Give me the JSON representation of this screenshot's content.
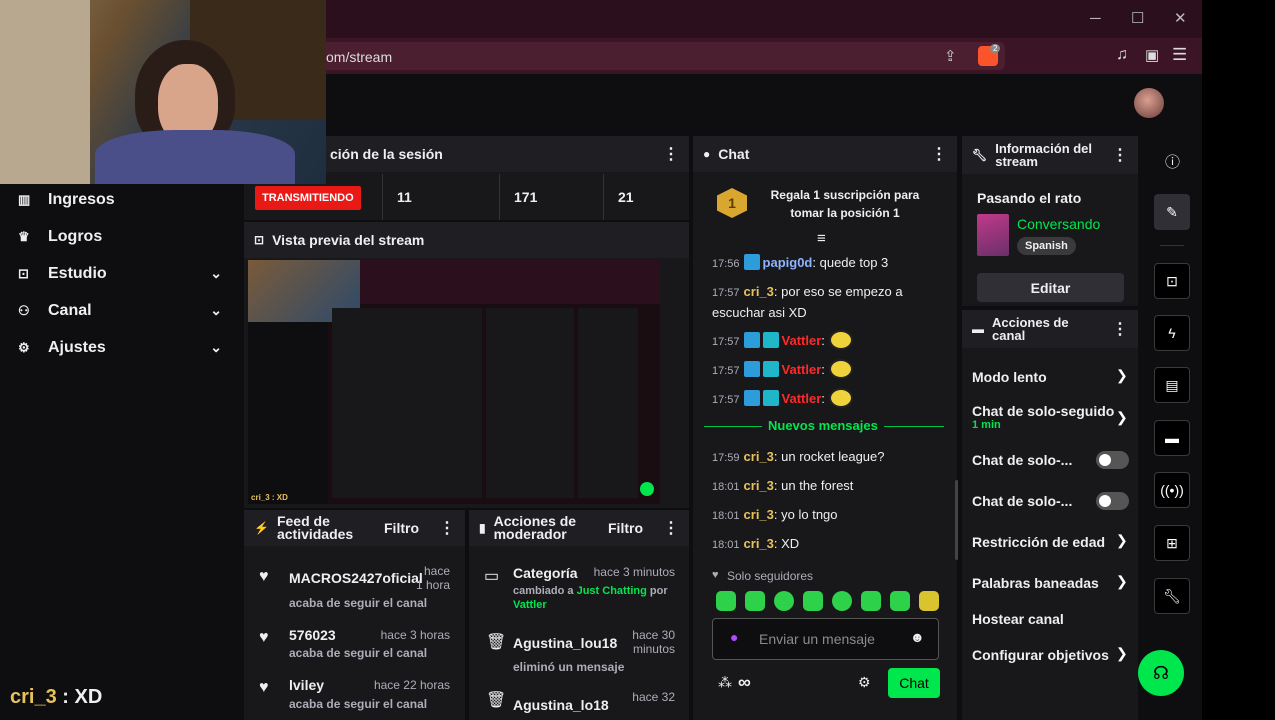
{
  "browser": {
    "url": "om/stream",
    "shield_count": "2",
    "window_controls": [
      "minimize-icon",
      "maximize-icon",
      "close-icon"
    ]
  },
  "sidebar": {
    "items": [
      {
        "label": "Ingresos",
        "icon": "chart-icon"
      },
      {
        "label": "Logros",
        "icon": "trophy-icon"
      },
      {
        "label": "Estudio",
        "icon": "camera-icon"
      },
      {
        "label": "Canal",
        "icon": "users-icon"
      },
      {
        "label": "Ajustes",
        "icon": "gear-icon"
      }
    ]
  },
  "session": {
    "title": "ción de la sesión",
    "status": "TRANSMITIENDO",
    "stats": [
      "11",
      "171",
      "21"
    ]
  },
  "preview": {
    "title": "Vista previa del stream",
    "caption": "cri_3 : XD"
  },
  "overlay_caption": {
    "user": "cri_3",
    "text": ": XD"
  },
  "chat": {
    "title": "Chat",
    "banner": "Regala 1 suscripción para tomar la posición 1",
    "banner_rank": "1",
    "messages_before": [
      {
        "time": "17:56",
        "user": "papig0d",
        "text": "quede top 3"
      },
      {
        "time": "17:57",
        "user": "cri_3",
        "text": "por eso se empezo a escuchar asi XD"
      },
      {
        "time": "17:57",
        "user": "Vattler",
        "text": ""
      },
      {
        "time": "17:57",
        "user": "Vattler",
        "text": ""
      },
      {
        "time": "17:57",
        "user": "Vattler",
        "text": ""
      }
    ],
    "new_messages_label": "Nuevos mensajes",
    "messages_after": [
      {
        "time": "17:59",
        "user": "cri_3",
        "text": "un rocket league?"
      },
      {
        "time": "18:01",
        "user": "cri_3",
        "text": "un the forest"
      },
      {
        "time": "18:01",
        "user": "cri_3",
        "text": "yo lo tngo"
      },
      {
        "time": "18:01",
        "user": "cri_3",
        "text": "XD"
      }
    ],
    "followers_only": "Solo seguidores",
    "input_placeholder": "Enviar un mensaje",
    "points": "∞",
    "send_label": "Chat"
  },
  "stream_info": {
    "title": "Información del stream",
    "stream_title": "Pasando el rato",
    "category": "Conversando",
    "language": "Spanish",
    "edit_label": "Editar"
  },
  "channel_actions": {
    "title": "Acciones de canal",
    "items": [
      {
        "label": "Modo lento",
        "sub": "",
        "control": "chevron"
      },
      {
        "label": "Chat de solo-seguido",
        "sub": "1 min",
        "control": "chevron"
      },
      {
        "label": "Chat de solo-...",
        "sub": "",
        "control": "toggle"
      },
      {
        "label": "Chat de solo-...",
        "sub": "",
        "control": "toggle"
      },
      {
        "label": "Restricción de edad",
        "sub": "",
        "control": "chevron"
      },
      {
        "label": "Palabras baneadas",
        "sub": "",
        "control": "chevron"
      },
      {
        "label": "Hostear canal",
        "sub": "",
        "control": "none"
      },
      {
        "label": "Configurar objetivos",
        "sub": "",
        "control": "chevron"
      }
    ]
  },
  "activity_feed": {
    "title": "Feed de actividades",
    "filter": "Filtro",
    "items": [
      {
        "name": "MACROS2427oficial",
        "sub": "acaba de seguir el canal",
        "time": "hace 1 hora"
      },
      {
        "name": "576023",
        "sub": "acaba de seguir el canal",
        "time": "hace 3 horas"
      },
      {
        "name": "lviley",
        "sub": "acaba de seguir el canal",
        "time": "hace 22 horas"
      }
    ]
  },
  "mod_actions": {
    "title": "Acciones de moderador",
    "filter": "Filtro",
    "items": [
      {
        "name": "Categoría",
        "sub_prefix": "cambiado a ",
        "sub_highlight": "Just Chatting",
        "sub_mid": " por ",
        "sub_user": "Vattler",
        "time": "hace 3 minutos"
      },
      {
        "name": "Agustina_lou18",
        "sub_prefix": "eliminó un mensaje",
        "sub_highlight": "",
        "sub_mid": "",
        "sub_user": "",
        "time": "hace 30 minutos"
      },
      {
        "name": "Agustina_lo18",
        "sub_prefix": "",
        "sub_highlight": "",
        "sub_mid": "",
        "sub_user": "",
        "time": "hace 32"
      }
    ]
  },
  "colors": {
    "accent": "#00e64d",
    "live": "#e91916",
    "panel": "#18181b"
  }
}
